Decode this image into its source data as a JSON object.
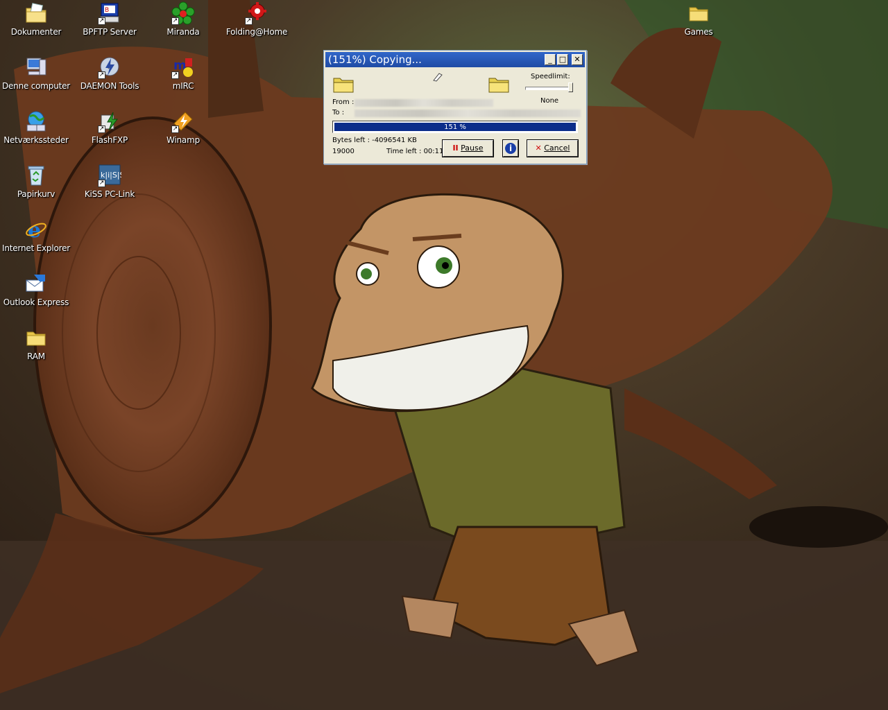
{
  "desktop_icons": [
    {
      "id": "dokumenter",
      "label": "Dokumenter",
      "icon": "documents-folder-icon",
      "shortcut": false
    },
    {
      "id": "bpftp",
      "label": "BPFTP Server",
      "icon": "bpftp-server-icon",
      "shortcut": true
    },
    {
      "id": "miranda",
      "label": "Miranda",
      "icon": "miranda-flower-icon",
      "shortcut": true
    },
    {
      "id": "folding",
      "label": "Folding@Home",
      "icon": "folding-gear-icon",
      "shortcut": true
    },
    {
      "id": "games",
      "label": "Games",
      "icon": "folder-icon",
      "shortcut": false
    },
    {
      "id": "computer",
      "label": "Denne computer",
      "icon": "computer-icon",
      "shortcut": false
    },
    {
      "id": "daemon",
      "label": "DAEMON Tools",
      "icon": "daemon-tools-icon",
      "shortcut": true
    },
    {
      "id": "mirc",
      "label": "mIRC",
      "icon": "mirc-icon",
      "shortcut": true
    },
    {
      "id": "network",
      "label": "Netværkssteder",
      "icon": "network-places-icon",
      "shortcut": false
    },
    {
      "id": "flashfxp",
      "label": "FlashFXP",
      "icon": "flashfxp-icon",
      "shortcut": true
    },
    {
      "id": "winamp",
      "label": "Winamp",
      "icon": "winamp-icon",
      "shortcut": true
    },
    {
      "id": "recycle",
      "label": "Papirkurv",
      "icon": "recycle-bin-icon",
      "shortcut": false
    },
    {
      "id": "kiss",
      "label": "KiSS PC-Link",
      "icon": "kiss-pc-link-icon",
      "shortcut": true
    },
    {
      "id": "ie",
      "label": "Internet Explorer",
      "icon": "internet-explorer-icon",
      "shortcut": false
    },
    {
      "id": "outlook",
      "label": "Outlook Express",
      "icon": "outlook-express-icon",
      "shortcut": false
    },
    {
      "id": "ram",
      "label": "RAM",
      "icon": "folder-icon",
      "shortcut": false
    }
  ],
  "dialog": {
    "title": "(151%) Copying...",
    "controls": {
      "minimize": "_",
      "maximize": "□",
      "close": "✕"
    },
    "speedlimit_label": "Speedlimit:",
    "speedlimit_value": "None",
    "speedlimit_level": 1.0,
    "from_label": "From :",
    "to_label": "To    :",
    "progress_text": "151 %",
    "progress_fraction": 1.0,
    "bytes_left": "Bytes left : -4096541 KB",
    "speed_value": "19000",
    "time_left": "Time left : 00:11",
    "pause_label": "Pause",
    "info_label": "i",
    "cancel_label": "Cancel"
  }
}
